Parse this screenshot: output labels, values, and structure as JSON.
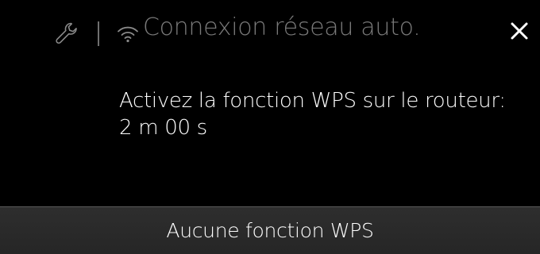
{
  "header": {
    "settings_icon": "wrench-icon",
    "network_icon": "wifi-icon",
    "title": "Connexion réseau auto.",
    "close_icon": "close-icon"
  },
  "message": {
    "instruction": "Activez la fonction WPS sur le routeur:",
    "countdown": "2 m 00 s"
  },
  "footer": {
    "button_label": "Aucune fonction WPS"
  },
  "colors": {
    "background": "#000000",
    "title_text": "#7a7a7a",
    "body_text": "#ffffff",
    "button_background": "#2b2b2b",
    "button_border": "#5a5a5a"
  }
}
